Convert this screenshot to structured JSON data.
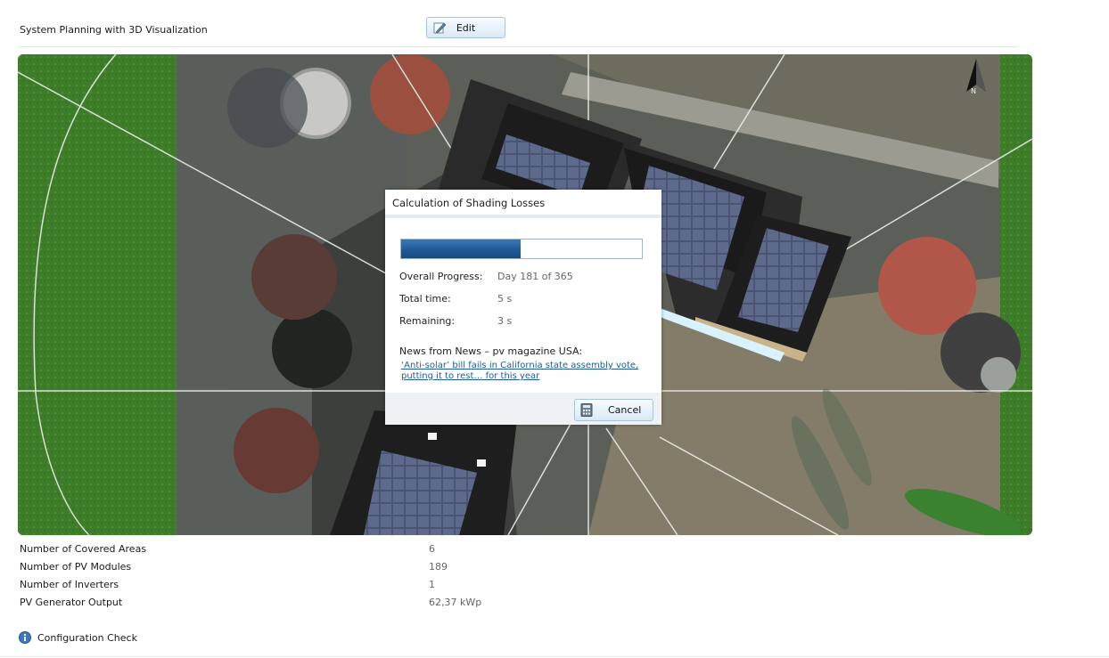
{
  "header": {
    "title": "System Planning with 3D Visualization",
    "edit_label": "Edit"
  },
  "view3d": {
    "compass_label": "N"
  },
  "dialog": {
    "title": "Calculation of Shading Losses",
    "progress_fraction": 0.4959,
    "rows": [
      {
        "label": "Overall Progress:",
        "value": "Day 181 of 365"
      },
      {
        "label": "Total time:",
        "value": "5 s"
      },
      {
        "label": "Remaining:",
        "value": "3 s"
      }
    ],
    "news_heading": "News from News – pv magazine USA:",
    "news_link": "‘Anti-solar’ bill fails in California state assembly vote, putting it to rest… for this year",
    "cancel_label": "Cancel"
  },
  "stats": [
    {
      "label": "Number of Covered Areas",
      "value": "6"
    },
    {
      "label": "Number of PV Modules",
      "value": "189"
    },
    {
      "label": "Number of Inverters",
      "value": "1"
    },
    {
      "label": "PV Generator Output",
      "value": "62,37 kWp"
    }
  ],
  "footer": {
    "config_check_label": "Configuration Check"
  },
  "colors": {
    "accent": "#1f5a98",
    "grass": "#3f7f2a",
    "roof": "#1e1e1e",
    "panel": "#4a5472"
  }
}
